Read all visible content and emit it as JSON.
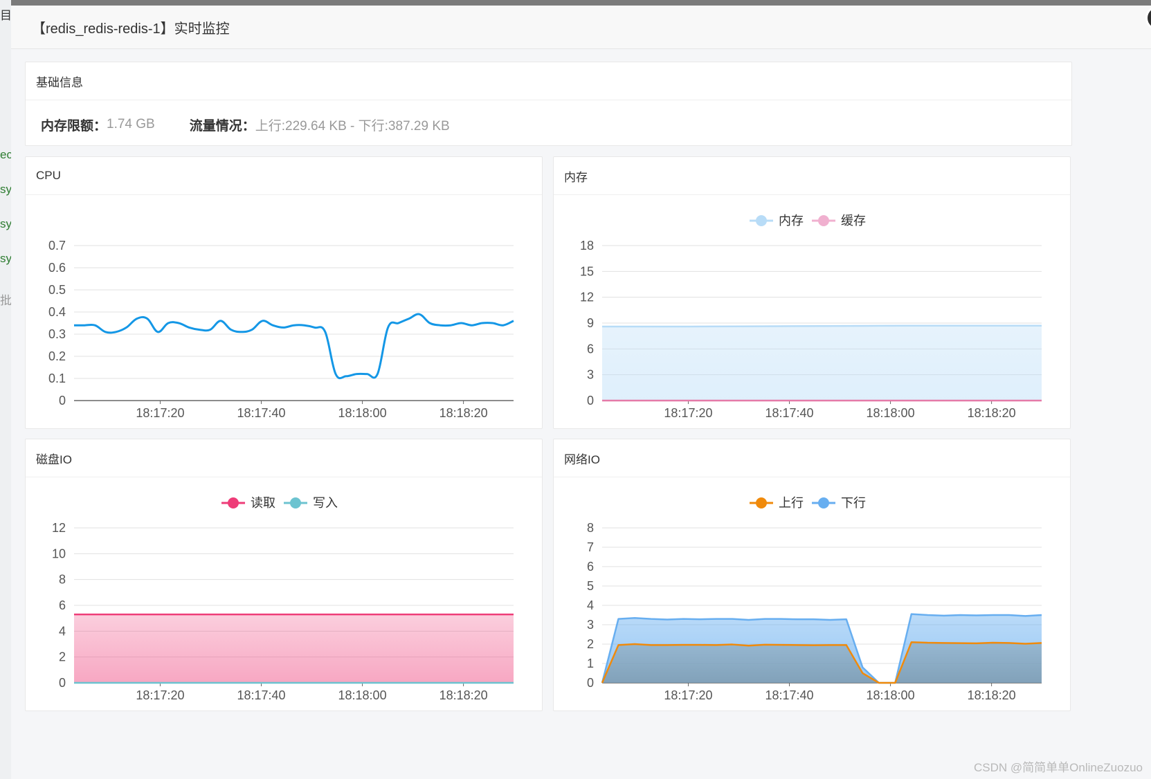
{
  "title": "【redis_redis-redis-1】实时监控",
  "basic": {
    "header": "基础信息",
    "mem_label": "内存限额：",
    "mem_value": "1.74 GB",
    "net_label": "流量情况：",
    "net_value": "上行:229.64 KB - 下行:387.29 KB"
  },
  "background_fragments": [
    "目",
    "ec",
    "sy",
    "sy",
    "sy",
    "批"
  ],
  "watermark": "CSDN @简简单单OnlineZuozuo",
  "colors": {
    "cpu_line": "#1497e6",
    "mem": "#b8dcf7",
    "cache": "#f0b0cf",
    "read": "#ee3c78",
    "write": "#6cc3d0",
    "up": "#f08a0b",
    "down": "#67aef0"
  },
  "charts": [
    {
      "key": "cpu",
      "header": "CPU",
      "chart_data": {
        "type": "line",
        "yticks": [
          "0",
          "0.1",
          "0.2",
          "0.3",
          "0.4",
          "0.5",
          "0.6",
          "0.7"
        ],
        "ylim": [
          0,
          0.7
        ],
        "xticks": [
          "18:17:20",
          "18:17:40",
          "18:18:00",
          "18:18:20"
        ],
        "legend": [],
        "series": [
          {
            "color": "#1497e6",
            "area": false,
            "smooth": true,
            "values": [
              0.34,
              0.34,
              0.34,
              0.31,
              0.31,
              0.33,
              0.37,
              0.37,
              0.31,
              0.35,
              0.35,
              0.33,
              0.32,
              0.32,
              0.36,
              0.32,
              0.31,
              0.32,
              0.36,
              0.34,
              0.33,
              0.34,
              0.34,
              0.33,
              0.31,
              0.12,
              0.11,
              0.12,
              0.12,
              0.12,
              0.33,
              0.35,
              0.37,
              0.39,
              0.35,
              0.34,
              0.34,
              0.35,
              0.34,
              0.35,
              0.35,
              0.34,
              0.36
            ]
          }
        ]
      }
    },
    {
      "key": "mem",
      "header": "内存",
      "chart_data": {
        "type": "area",
        "yticks": [
          "0",
          "3",
          "6",
          "9",
          "12",
          "15",
          "18"
        ],
        "ylim": [
          0,
          18
        ],
        "xticks": [
          "18:17:20",
          "18:17:40",
          "18:18:00",
          "18:18:20"
        ],
        "legend": [
          {
            "label": "内存",
            "color": "#b8dcf7"
          },
          {
            "label": "缓存",
            "color": "#f0b0cf"
          }
        ],
        "series": [
          {
            "name": "内存",
            "color": "#b8dcf7",
            "area": true,
            "values": [
              8.6,
              8.6,
              8.6,
              8.62,
              8.64,
              8.66,
              8.68,
              8.7,
              8.7,
              8.7,
              8.7
            ]
          },
          {
            "name": "缓存",
            "color": "#e57aa8",
            "area": false,
            "values": [
              0,
              0,
              0,
              0,
              0,
              0,
              0,
              0,
              0,
              0,
              0
            ]
          }
        ]
      }
    },
    {
      "key": "disk",
      "header": "磁盘IO",
      "chart_data": {
        "type": "area",
        "yticks": [
          "0",
          "2",
          "4",
          "6",
          "8",
          "10",
          "12"
        ],
        "ylim": [
          0,
          12
        ],
        "xticks": [
          "18:17:20",
          "18:17:40",
          "18:18:00",
          "18:18:20"
        ],
        "legend": [
          {
            "label": "读取",
            "color": "#ee3c78"
          },
          {
            "label": "写入",
            "color": "#6cc3d0"
          }
        ],
        "series": [
          {
            "name": "读取",
            "color": "#ee3c78",
            "area": true,
            "values": [
              5.3,
              5.3,
              5.3,
              5.3,
              5.3,
              5.3,
              5.3,
              5.3,
              5.3,
              5.3,
              5.3
            ]
          },
          {
            "name": "写入",
            "color": "#6cc3d0",
            "area": false,
            "values": [
              0,
              0,
              0,
              0,
              0,
              0,
              0,
              0,
              0,
              0,
              0
            ]
          }
        ]
      }
    },
    {
      "key": "net",
      "header": "网络IO",
      "chart_data": {
        "type": "area",
        "yticks": [
          "0",
          "1",
          "2",
          "3",
          "4",
          "5",
          "6",
          "7",
          "8"
        ],
        "ylim": [
          0,
          8
        ],
        "xticks": [
          "18:17:20",
          "18:17:40",
          "18:18:00",
          "18:18:20"
        ],
        "legend": [
          {
            "label": "上行",
            "color": "#f08a0b"
          },
          {
            "label": "下行",
            "color": "#67aef0"
          }
        ],
        "series": [
          {
            "name": "下行",
            "color": "#67aef0",
            "area": true,
            "values": [
              0,
              3.3,
              3.35,
              3.3,
              3.27,
              3.3,
              3.28,
              3.3,
              3.3,
              3.25,
              3.3,
              3.3,
              3.28,
              3.28,
              3.25,
              3.28,
              0.8,
              0,
              0,
              3.55,
              3.5,
              3.47,
              3.5,
              3.48,
              3.5,
              3.5,
              3.45,
              3.5
            ]
          },
          {
            "name": "上行",
            "color": "#f08a0b",
            "area": true,
            "values": [
              0,
              1.95,
              2.0,
              1.95,
              1.95,
              1.96,
              1.96,
              1.95,
              1.98,
              1.92,
              1.97,
              1.96,
              1.95,
              1.94,
              1.95,
              1.95,
              0.5,
              0,
              0,
              2.1,
              2.07,
              2.06,
              2.05,
              2.04,
              2.07,
              2.06,
              2.02,
              2.06
            ]
          }
        ]
      }
    }
  ]
}
